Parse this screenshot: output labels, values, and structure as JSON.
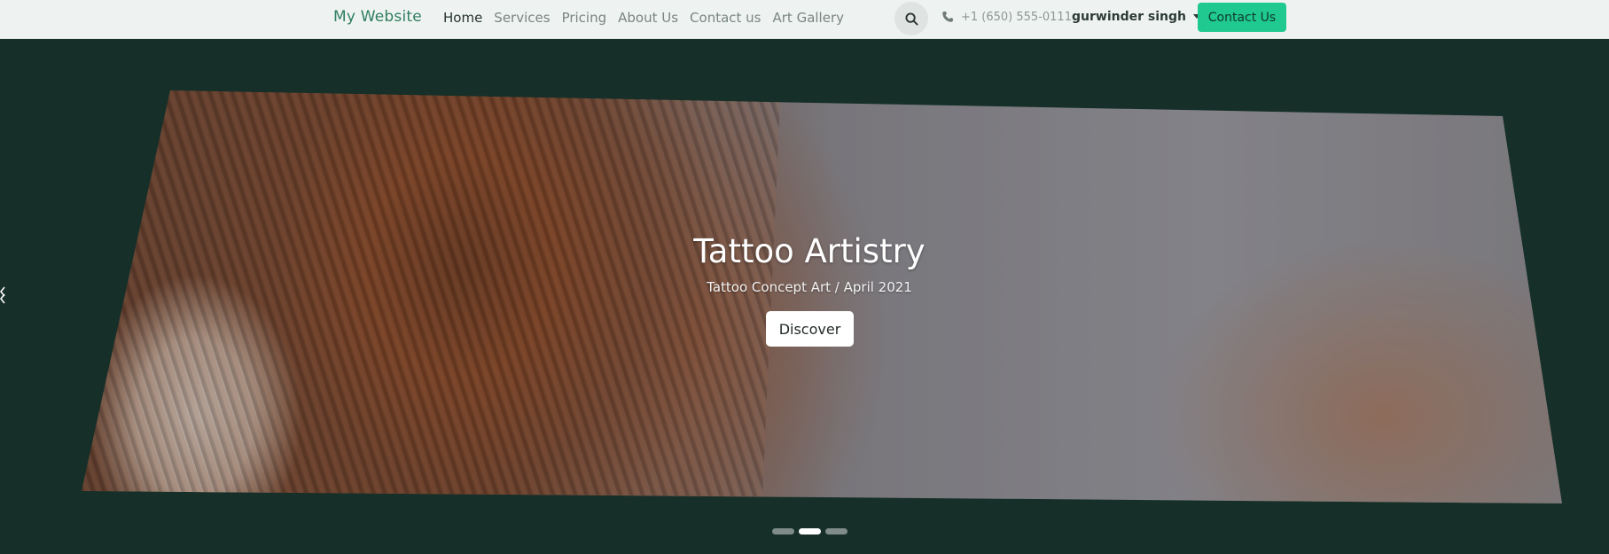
{
  "navbar": {
    "brand": "My Website",
    "links": [
      {
        "label": "Home",
        "active": true
      },
      {
        "label": "Services",
        "active": false
      },
      {
        "label": "Pricing",
        "active": false
      },
      {
        "label": "About Us",
        "active": false
      },
      {
        "label": "Contact us",
        "active": false
      },
      {
        "label": "Art Gallery",
        "active": false
      }
    ],
    "search_icon": "search-icon",
    "phone_icon": "phone-icon",
    "phone": "+1 (650) 555-0111",
    "user": "gurwinder singh",
    "cta_label": "Contact Us"
  },
  "hero": {
    "title": "Tattoo Artistry",
    "subtitle": "Tattoo Concept Art / April 2021",
    "button_label": "Discover",
    "slide_count": 3,
    "active_slide": 2
  },
  "colors": {
    "accent": "#1fc98f",
    "brand_text": "#2f7d5f",
    "page_background": "#162f28",
    "navbar_background": "#eef3f1"
  }
}
